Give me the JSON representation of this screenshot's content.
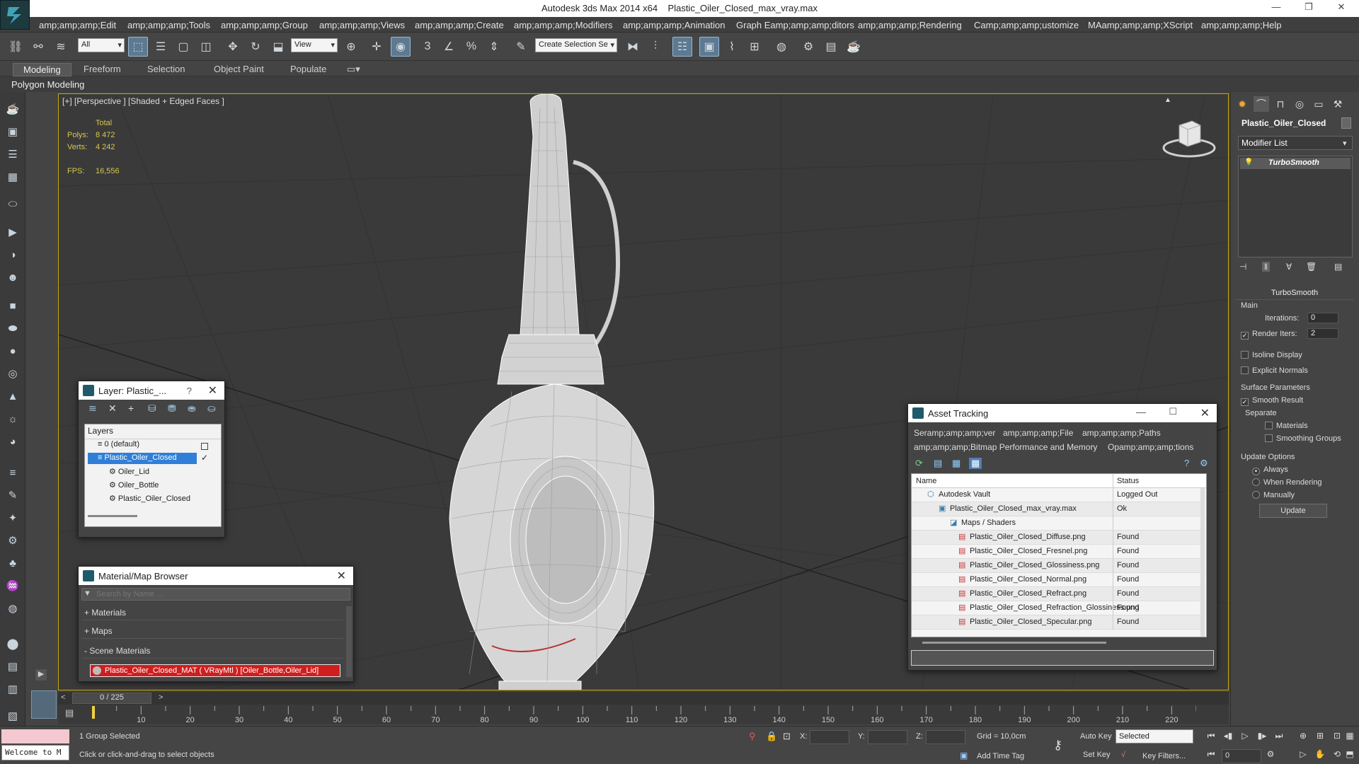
{
  "title": {
    "app": "Autodesk 3ds Max  2014 x64",
    "file": "Plastic_Oiler_Closed_max_vray.max"
  },
  "menu": [
    "amp;amp;amp;Edit",
    "amp;amp;amp;Tools",
    "amp;amp;amp;Group",
    "amp;amp;amp;Views",
    "amp;amp;amp;Create",
    "amp;amp;amp;Modifiers",
    "amp;amp;amp;Animation",
    "Graph Eamp;amp;amp;ditors",
    "amp;amp;amp;Rendering",
    "Camp;amp;amp;ustomize",
    "MAamp;amp;amp;XScript",
    "amp;amp;amp;Help"
  ],
  "toolbar": {
    "selection_filter": "All",
    "reference_coord": "View",
    "named_selection": "Create Selection Se"
  },
  "ribbon": {
    "tabs": [
      "Modeling",
      "Freeform",
      "Selection",
      "Object Paint",
      "Populate"
    ],
    "active": "Modeling",
    "panel": "Polygon Modeling"
  },
  "viewport": {
    "label": "[+] [Perspective ] [Shaded + Edged Faces ]",
    "stats_header": "Total",
    "polys_label": "Polys:",
    "polys_value": "8 472",
    "verts_label": "Verts:",
    "verts_value": "4 242",
    "fps_label": "FPS:",
    "fps_value": "16,556",
    "wire_color": "#ffffff",
    "bg_color": "#3a3a3a"
  },
  "command_panel": {
    "object_name": "Plastic_Oiler_Closed",
    "modifier_list": "Modifier List",
    "stack_item": "TurboSmooth",
    "rollout_title": "TurboSmooth",
    "main_label": "Main",
    "iterations_label": "Iterations:",
    "iterations_value": "0",
    "render_iters_label": "Render Iters:",
    "render_iters_value": "2",
    "isoline_display": "Isoline Display",
    "explicit_normals": "Explicit Normals",
    "surface_parameters": "Surface Parameters",
    "smooth_result": "Smooth Result",
    "separate": "Separate",
    "materials": "Materials",
    "smoothing_groups": "Smoothing Groups",
    "update_options": "Update Options",
    "always": "Always",
    "when_rendering": "When Rendering",
    "manually": "Manually",
    "update_button": "Update"
  },
  "layer_window": {
    "title": "Layer: Plastic_...",
    "help": "?",
    "header": "Layers",
    "items": [
      {
        "label": "0 (default)"
      },
      {
        "label": "Plastic_Oiler_Closed"
      },
      {
        "label": "Oiler_Lid"
      },
      {
        "label": "Oiler_Bottle"
      },
      {
        "label": "Plastic_Oiler_Closed"
      }
    ]
  },
  "material_browser": {
    "title": "Material/Map Browser",
    "search_placeholder": "Search by Name ...",
    "materials": "+ Materials",
    "maps": "+ Maps",
    "scene_materials": "- Scene Materials",
    "scene_item": "Plastic_Oiler_Closed_MAT ( VRayMtl ) [Oiler_Bottle,Oiler_Lid]"
  },
  "asset_tracking": {
    "title": "Asset Tracking",
    "menu_row1": [
      "Seramp;amp;amp;ver",
      "amp;amp;amp;File",
      "amp;amp;amp;Paths"
    ],
    "menu_row2": [
      "amp;amp;amp;Bitmap Performance and Memory",
      "Opamp;amp;amp;tions"
    ],
    "col_name": "Name",
    "col_status": "Status",
    "rows": [
      {
        "name": "Autodesk Vault",
        "status": "Logged Out"
      },
      {
        "name": "Plastic_Oiler_Closed_max_vray.max",
        "status": "Ok"
      },
      {
        "name": "Maps / Shaders",
        "status": ""
      },
      {
        "name": "Plastic_Oiler_Closed_Diffuse.png",
        "status": "Found"
      },
      {
        "name": "Plastic_Oiler_Closed_Fresnel.png",
        "status": "Found"
      },
      {
        "name": "Plastic_Oiler_Closed_Glossiness.png",
        "status": "Found"
      },
      {
        "name": "Plastic_Oiler_Closed_Normal.png",
        "status": "Found"
      },
      {
        "name": "Plastic_Oiler_Closed_Refract.png",
        "status": "Found"
      },
      {
        "name": "Plastic_Oiler_Closed_Refraction_Glossiness.png",
        "status": "Found"
      },
      {
        "name": "Plastic_Oiler_Closed_Specular.png",
        "status": "Found"
      }
    ]
  },
  "timeline": {
    "frame": "0 / 225",
    "ticks": [
      "10",
      "20",
      "30",
      "40",
      "50",
      "60",
      "70",
      "80",
      "90",
      "100",
      "110",
      "120",
      "130",
      "140",
      "150",
      "160",
      "170",
      "180",
      "190",
      "200",
      "210",
      "220"
    ]
  },
  "status": {
    "maxscript": "Welcome to M",
    "selection": "1 Group Selected",
    "prompt": "Click or click-and-drag to select objects",
    "x_label": "X:",
    "y_label": "Y:",
    "z_label": "Z:",
    "grid": "Grid = 10,0cm",
    "add_time_tag": "Add Time Tag",
    "auto_key": "Auto Key",
    "set_key": "Set Key",
    "key_mode": "Selected",
    "key_filters": "Key Filters...",
    "frame_field": "0"
  }
}
